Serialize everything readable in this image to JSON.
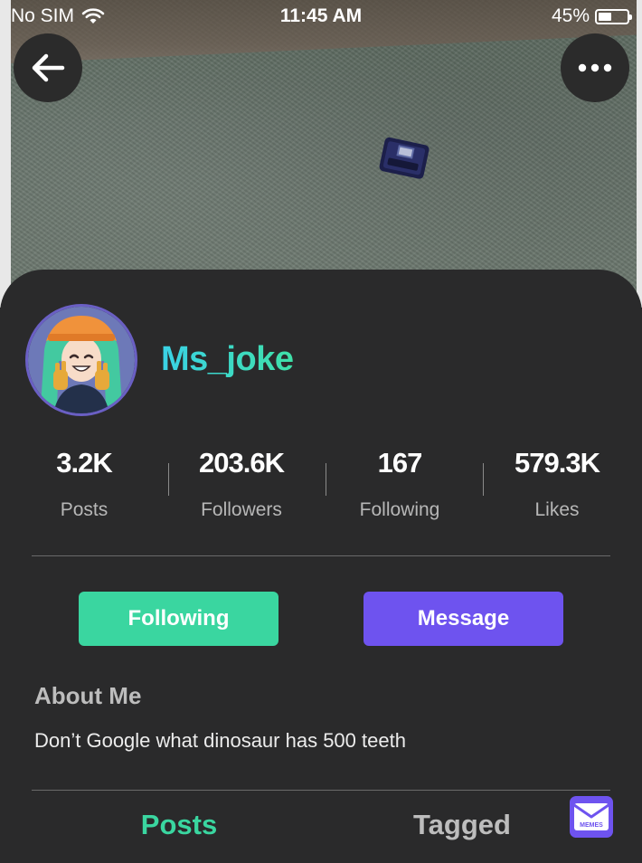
{
  "status_bar": {
    "carrier": "No SIM",
    "time": "11:45 AM",
    "battery_percent": "45%",
    "battery_level": 0.45
  },
  "nav": {
    "back_icon": "back-arrow-icon",
    "more_icon": "more-dots-icon"
  },
  "profile": {
    "username": "Ms_joke",
    "avatar_icon": "anime-avatar"
  },
  "stats": [
    {
      "value": "3.2K",
      "label": "Posts"
    },
    {
      "value": "203.6K",
      "label": "Followers"
    },
    {
      "value": "167",
      "label": "Following"
    },
    {
      "value": "579.3K",
      "label": "Likes"
    }
  ],
  "actions": {
    "following_label": "Following",
    "message_label": "Message"
  },
  "about": {
    "title": "About Me",
    "text": "Don’t Google what dinosaur has 500 teeth"
  },
  "tabs": [
    {
      "label": "Posts",
      "active": true
    },
    {
      "label": "Tagged",
      "active": false
    }
  ],
  "badge": {
    "label": "MEMES"
  },
  "colors": {
    "background": "#2a2a2b",
    "accent_green": "#3ad6a0",
    "accent_purple": "#6e53ef",
    "username_gradient_start": "#3ad2e6",
    "username_gradient_end": "#3fe0a8"
  }
}
